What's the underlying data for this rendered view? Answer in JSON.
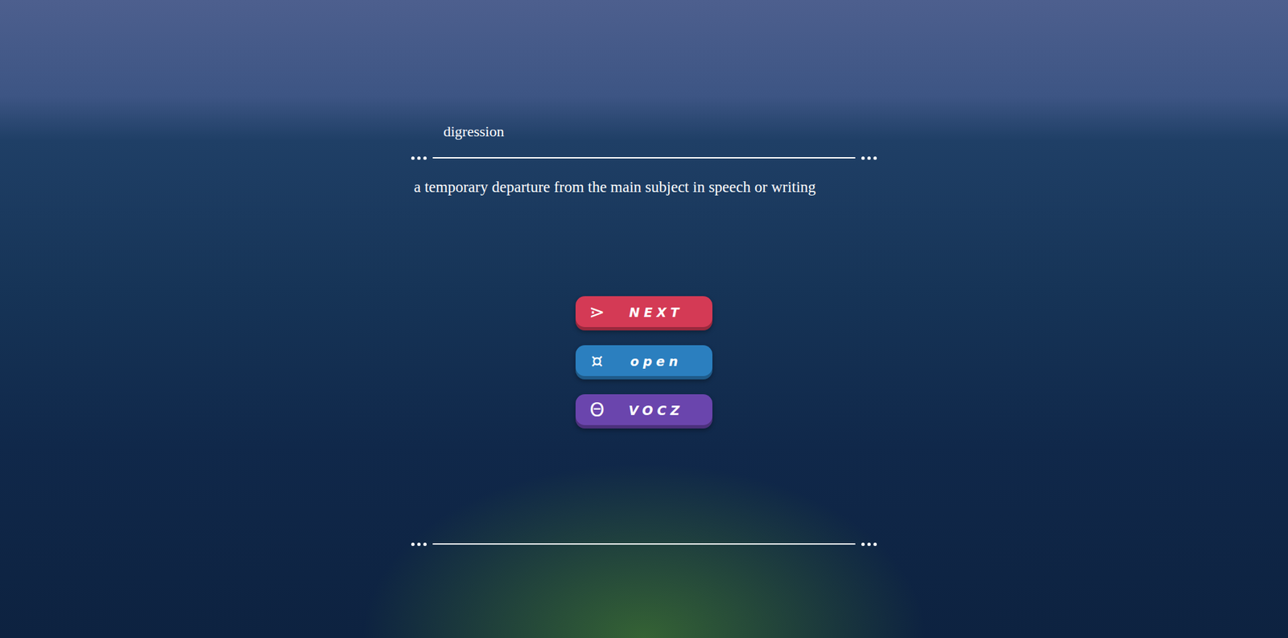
{
  "word": "digression",
  "definition": "a temporary departure from the main subject in speech or writing",
  "buttons": [
    {
      "icon": "⋗",
      "label": "NEXT",
      "color": "#d43a55"
    },
    {
      "icon": "¤",
      "label": "open",
      "color": "#2b7fbf"
    },
    {
      "icon": "Θ",
      "label": "VOCZ",
      "color": "#6a45ad"
    }
  ]
}
